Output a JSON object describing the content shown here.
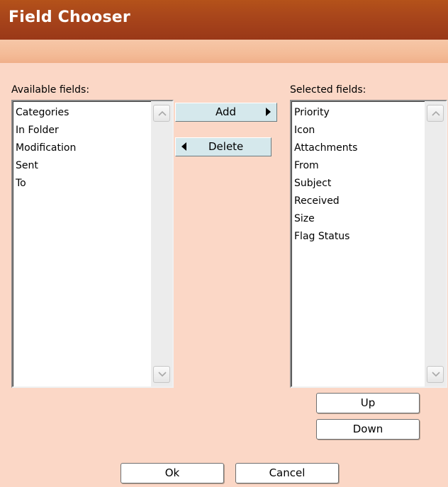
{
  "dialog": {
    "title": "Field Chooser"
  },
  "available": {
    "label": "Available fields:",
    "items": [
      "Categories",
      "In Folder",
      "Modification",
      "Sent",
      "To"
    ]
  },
  "selected": {
    "label": "Selected fields:",
    "items": [
      "Priority",
      "Icon",
      "Attachments",
      "From",
      "Subject",
      "Received",
      "Size",
      "Flag Status"
    ]
  },
  "buttons": {
    "add": "Add",
    "delete": "Delete",
    "up": "Up",
    "down": "Down",
    "ok": "Ok",
    "cancel": "Cancel"
  },
  "colors": {
    "titlebar": "#a9461b",
    "dialog_bg": "#fbd7c6",
    "move_button_bg": "#d5e8ec"
  },
  "icons": {
    "add_arrow": "triangle-right-icon",
    "delete_arrow": "triangle-left-icon",
    "scroll_up": "chevron-up-icon",
    "scroll_down": "chevron-down-icon"
  }
}
